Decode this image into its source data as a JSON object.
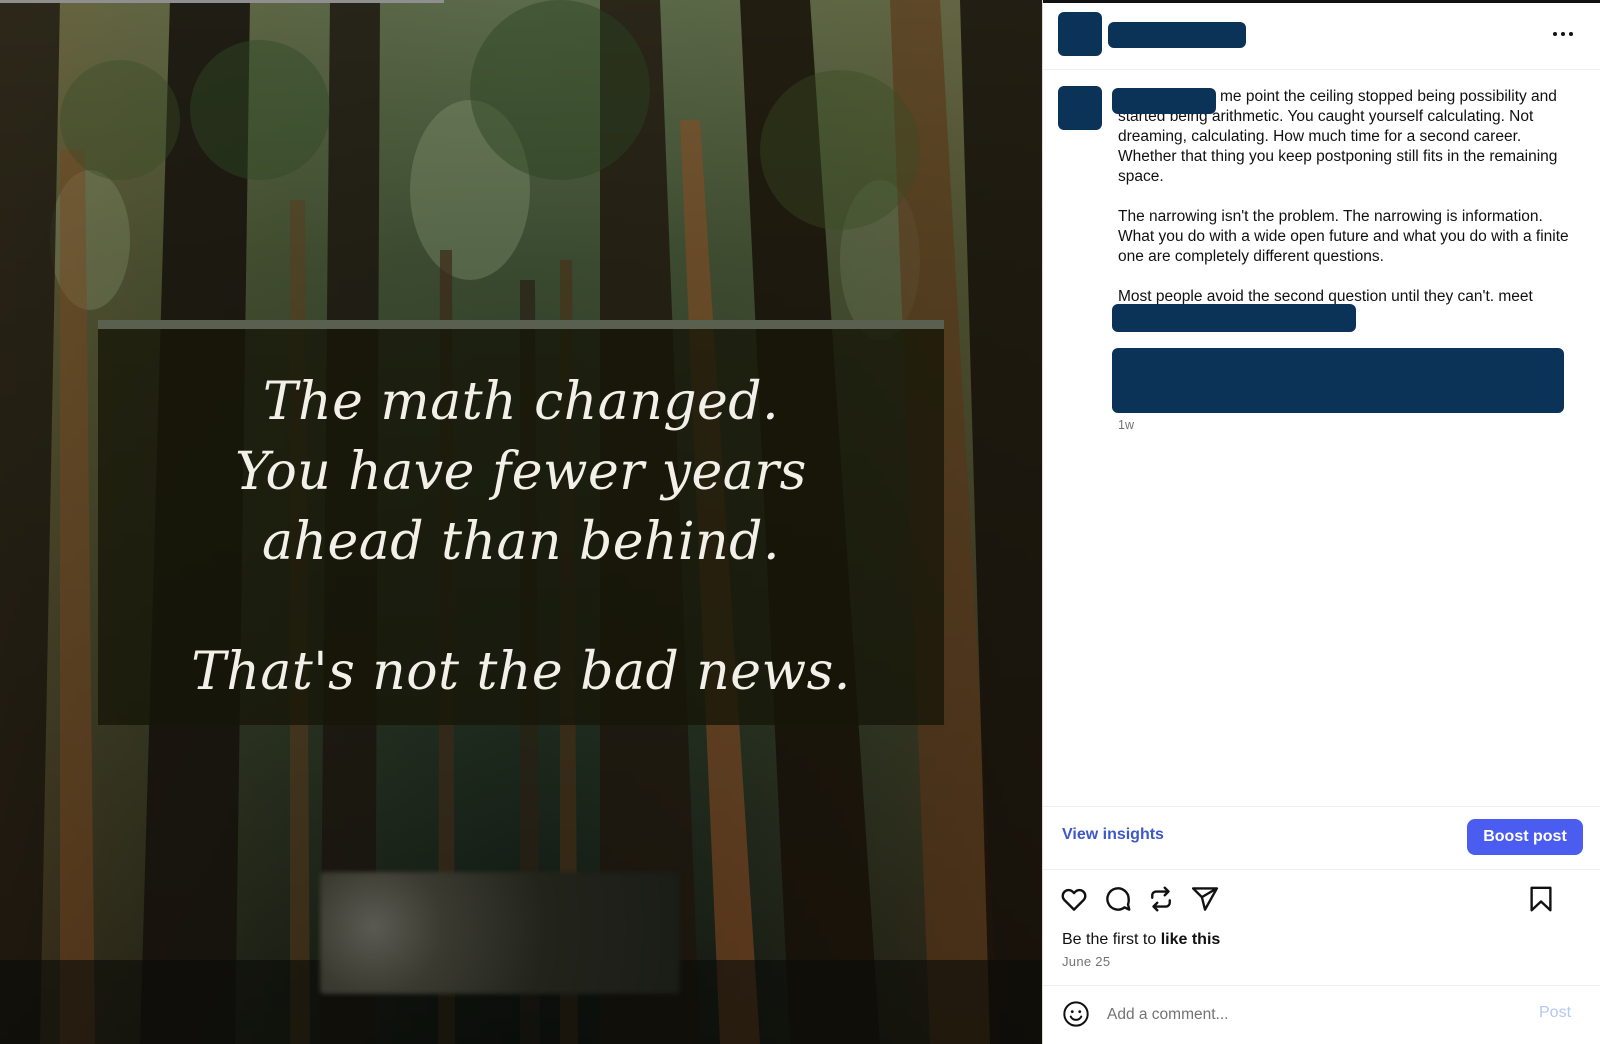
{
  "media": {
    "quote_lines": [
      "The math changed.",
      "You have fewer years",
      "ahead than behind."
    ],
    "quote_closing": "That's not the bad news."
  },
  "post": {
    "caption_paragraphs": [
      "me point the ceiling stopped being possibility and started being arithmetic. You caught yourself calculating. Not dreaming, calculating. How much time for a second career. Whether that thing you keep postponing still fits in the remaining space.",
      "The narrowing isn't the problem. The narrowing is information. What you do with a wide open future and what you do with a finite one are completely different questions.",
      "Most people avoid the second question until they can't. meet"
    ],
    "time_ago": "1w"
  },
  "insights": {
    "view_label": "View insights",
    "boost_label": "Boost post"
  },
  "engagement": {
    "likes_prefix": "Be the first to ",
    "likes_action": "like this",
    "date": "June 25"
  },
  "comment": {
    "placeholder": "Add a comment...",
    "post_label": "Post"
  },
  "icons": [
    "more-icon",
    "heart-icon",
    "comment-icon",
    "repost-icon",
    "share-icon",
    "bookmark-icon",
    "emoji-icon"
  ],
  "colors": {
    "redaction": "#0b3358",
    "accent": "#4a5df0",
    "link": "#3d58c9"
  }
}
